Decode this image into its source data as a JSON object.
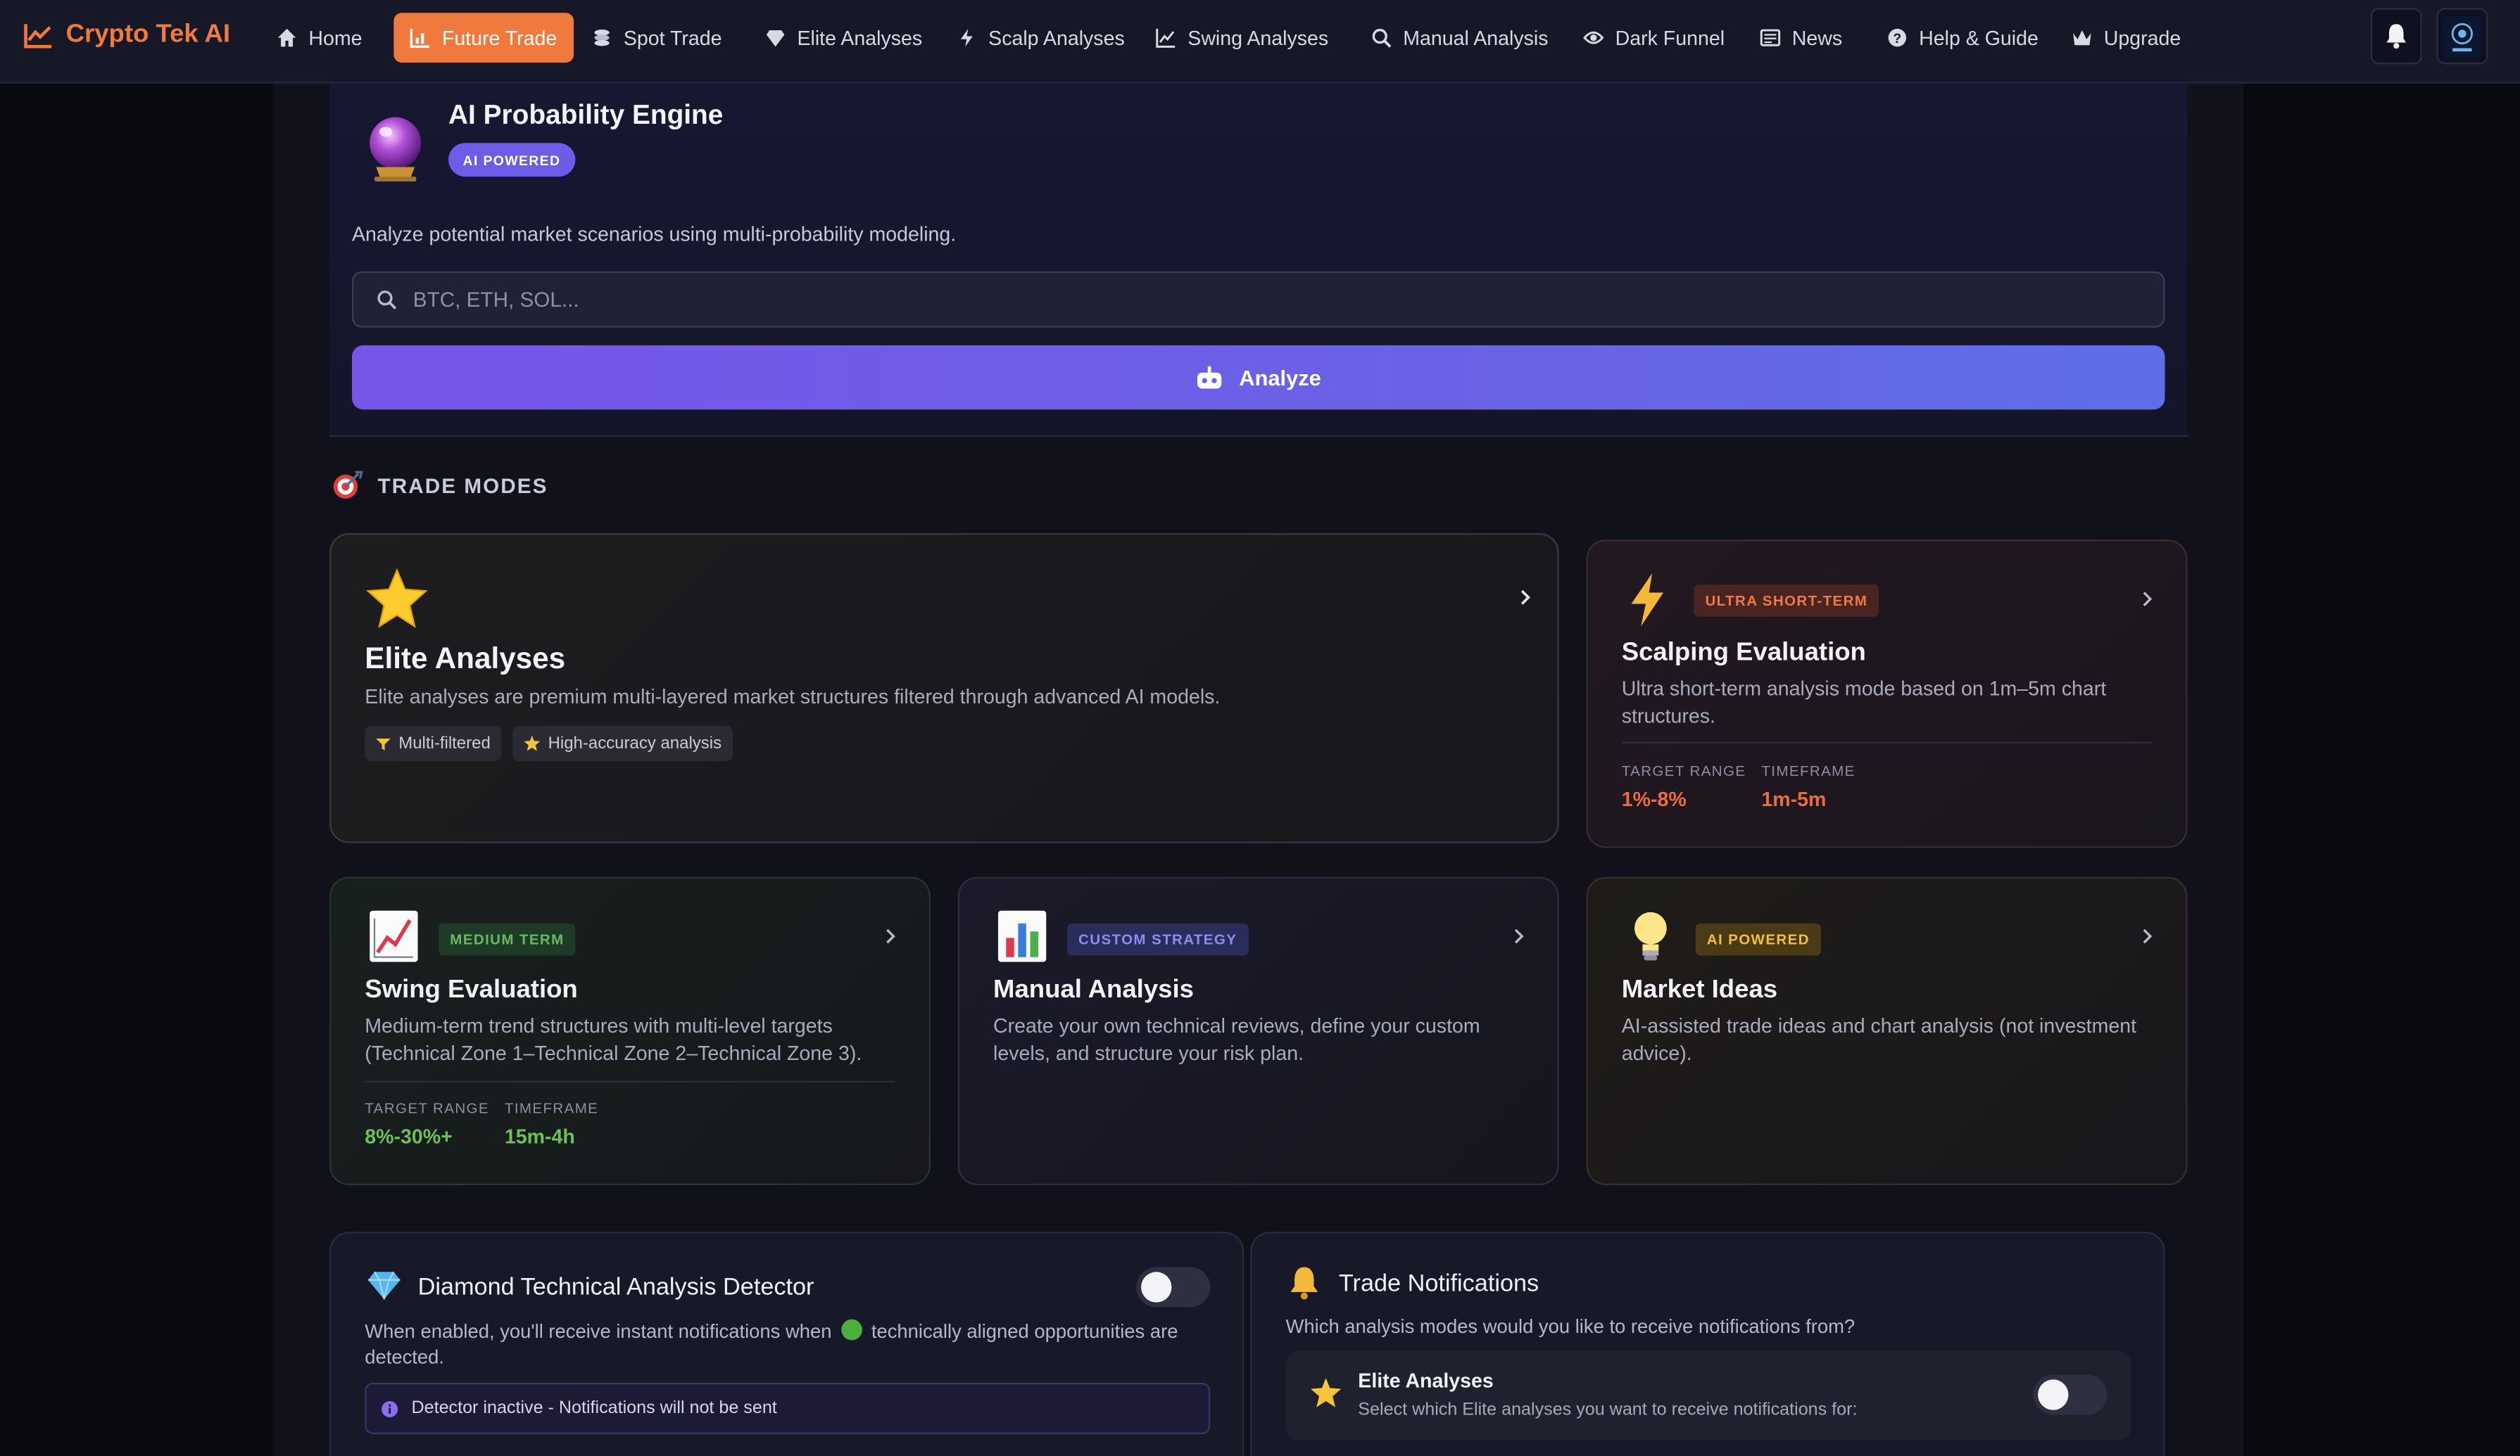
{
  "brand": {
    "name": "Crypto Tek AI"
  },
  "nav": {
    "items": [
      {
        "label": "Home",
        "icon": "home-icon",
        "active": false
      },
      {
        "label": "Future Trade",
        "icon": "chart-icon",
        "active": true
      },
      {
        "label": "Spot Trade",
        "icon": "coins-icon",
        "active": false
      },
      {
        "label": "Elite Analyses",
        "icon": "diamond-icon",
        "active": false
      },
      {
        "label": "Scalp Analyses",
        "icon": "bolt-icon",
        "active": false
      },
      {
        "label": "Swing Analyses",
        "icon": "line-chart-icon",
        "active": false
      },
      {
        "label": "Manual Analysis",
        "icon": "search-icon",
        "active": false
      },
      {
        "label": "Dark Funnel",
        "icon": "eye-icon",
        "active": false
      },
      {
        "label": "News",
        "icon": "newspaper-icon",
        "active": false
      },
      {
        "label": "Help & Guide",
        "icon": "help-icon",
        "active": false
      },
      {
        "label": "Upgrade",
        "icon": "crown-icon",
        "active": false
      }
    ]
  },
  "engine": {
    "title": "AI Probability Engine",
    "badge": "AI POWERED",
    "description": "Analyze potential market scenarios using multi-probability modeling.",
    "search_placeholder": "BTC, ETH, SOL...",
    "search_value": "",
    "analyze_label": "Analyze"
  },
  "modes": {
    "heading": "TRADE MODES",
    "elite": {
      "title": "Elite Analyses",
      "description": "Elite analyses are premium multi-layered market structures filtered through advanced AI models.",
      "pills": [
        "Multi-filtered",
        "High-accuracy analysis"
      ]
    },
    "scalp": {
      "tag": "ULTRA SHORT-TERM",
      "title": "Scalping Evaluation",
      "description": "Ultra short-term analysis mode based on 1m–5m chart structures.",
      "target_label": "TARGET RANGE",
      "target_value": "1%-8%",
      "timeframe_label": "TIMEFRAME",
      "timeframe_value": "1m-5m"
    },
    "swing": {
      "tag": "MEDIUM TERM",
      "title": "Swing Evaluation",
      "description": "Medium-term trend structures with multi-level targets (Technical Zone 1–Technical Zone 2–Technical Zone 3).",
      "target_label": "TARGET RANGE",
      "target_value": "8%-30%+",
      "timeframe_label": "TIMEFRAME",
      "timeframe_value": "15m-4h"
    },
    "manual": {
      "tag": "CUSTOM STRATEGY",
      "title": "Manual Analysis",
      "description": "Create your own technical reviews, define your custom levels, and structure your risk plan."
    },
    "ideas": {
      "tag": "AI POWERED",
      "title": "Market Ideas",
      "description": "AI-assisted trade ideas and chart analysis (not investment advice)."
    }
  },
  "detector": {
    "title": "Diamond Technical Analysis Detector",
    "enabled": false,
    "description_1": "When enabled, you'll receive instant notifications when",
    "description_2": "technically aligned opportunities are detected.",
    "status": "Detector inactive - Notifications will not be sent"
  },
  "notifications": {
    "title": "Trade Notifications",
    "subtitle": "Which analysis modes would you like to receive notifications from?",
    "elite_title": "Elite Analyses",
    "elite_desc": "Select which Elite analyses you want to receive notifications for:",
    "elite_enabled": false
  },
  "colors": {
    "accent": "#f07a3d",
    "purple": "#6c5ce7",
    "swing_green": "#6fbf5a",
    "scalp_orange": "#e8733a"
  }
}
